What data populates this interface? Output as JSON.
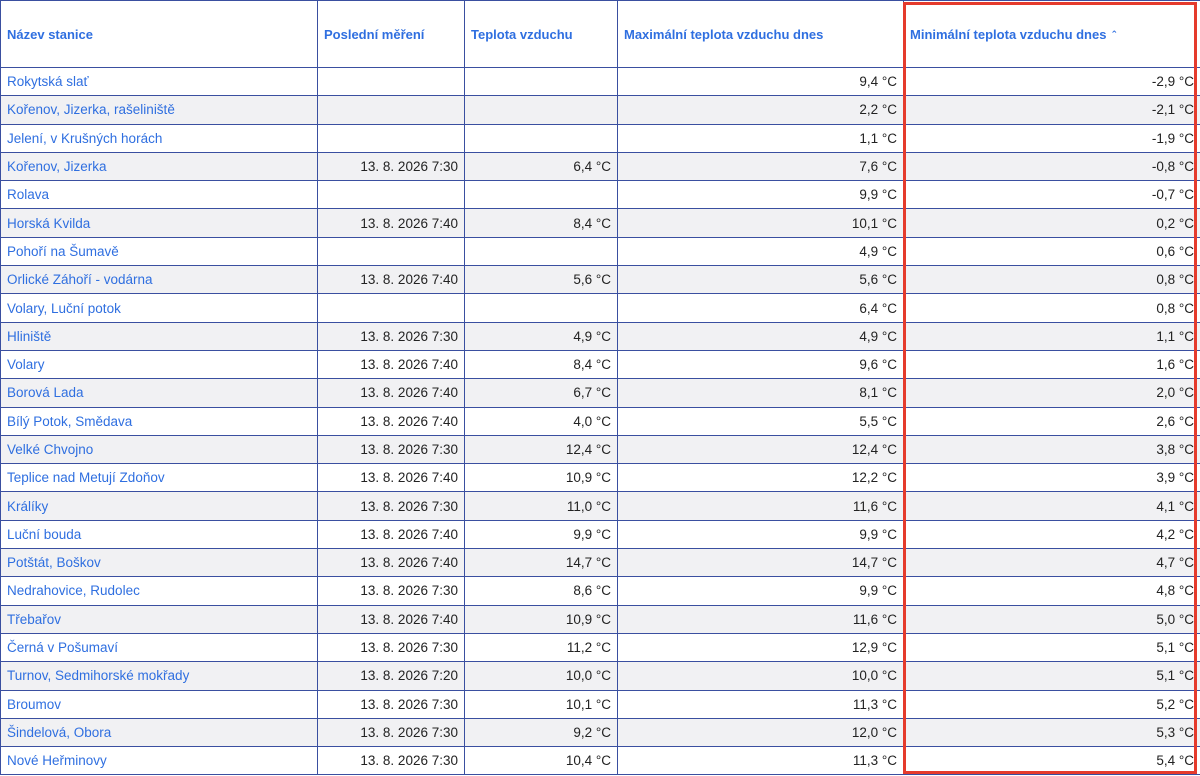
{
  "headers": {
    "station": "Název stanice",
    "last": "Poslední měření",
    "temp": "Teplota vzduchu",
    "max": "Maximální teplota vzduchu dnes",
    "min": "Minimální teplota vzduchu dnes",
    "sort_icon": "chevron-up-icon"
  },
  "colors": {
    "link": "#2f6fe0",
    "highlight": "#e53b2c",
    "grid": "#3a4fa0"
  },
  "rows": [
    {
      "station": "Rokytská slať",
      "last": "",
      "temp": "",
      "max": "9,4 °C",
      "min": "-2,9 °C"
    },
    {
      "station": "Kořenov, Jizerka, rašeliniště",
      "last": "",
      "temp": "",
      "max": "2,2 °C",
      "min": "-2,1 °C"
    },
    {
      "station": "Jelení, v Krušných horách",
      "last": "",
      "temp": "",
      "max": "1,1 °C",
      "min": "-1,9 °C"
    },
    {
      "station": "Kořenov, Jizerka",
      "last": "13. 8. 2026 7:30",
      "temp": "6,4 °C",
      "max": "7,6 °C",
      "min": "-0,8 °C"
    },
    {
      "station": "Rolava",
      "last": "",
      "temp": "",
      "max": "9,9 °C",
      "min": "-0,7 °C"
    },
    {
      "station": "Horská Kvilda",
      "last": "13. 8. 2026 7:40",
      "temp": "8,4 °C",
      "max": "10,1 °C",
      "min": "0,2 °C"
    },
    {
      "station": "Pohoří na Šumavě",
      "last": "",
      "temp": "",
      "max": "4,9 °C",
      "min": "0,6 °C"
    },
    {
      "station": "Orlické Záhoří - vodárna",
      "last": "13. 8. 2026 7:40",
      "temp": "5,6 °C",
      "max": "5,6 °C",
      "min": "0,8 °C"
    },
    {
      "station": "Volary, Luční potok",
      "last": "",
      "temp": "",
      "max": "6,4 °C",
      "min": "0,8 °C"
    },
    {
      "station": "Hliniště",
      "last": "13. 8. 2026 7:30",
      "temp": "4,9 °C",
      "max": "4,9 °C",
      "min": "1,1 °C"
    },
    {
      "station": "Volary",
      "last": "13. 8. 2026 7:40",
      "temp": "8,4 °C",
      "max": "9,6 °C",
      "min": "1,6 °C"
    },
    {
      "station": "Borová Lada",
      "last": "13. 8. 2026 7:40",
      "temp": "6,7 °C",
      "max": "8,1 °C",
      "min": "2,0 °C"
    },
    {
      "station": "Bílý Potok, Smědava",
      "last": "13. 8. 2026 7:40",
      "temp": "4,0 °C",
      "max": "5,5 °C",
      "min": "2,6 °C"
    },
    {
      "station": "Velké Chvojno",
      "last": "13. 8. 2026 7:30",
      "temp": "12,4 °C",
      "max": "12,4 °C",
      "min": "3,8 °C"
    },
    {
      "station": "Teplice nad Metují Zdoňov",
      "last": "13. 8. 2026 7:40",
      "temp": "10,9 °C",
      "max": "12,2 °C",
      "min": "3,9 °C"
    },
    {
      "station": "Králíky",
      "last": "13. 8. 2026 7:30",
      "temp": "11,0 °C",
      "max": "11,6 °C",
      "min": "4,1 °C"
    },
    {
      "station": "Luční bouda",
      "last": "13. 8. 2026 7:40",
      "temp": "9,9 °C",
      "max": "9,9 °C",
      "min": "4,2 °C"
    },
    {
      "station": "Potštát, Boškov",
      "last": "13. 8. 2026 7:40",
      "temp": "14,7 °C",
      "max": "14,7 °C",
      "min": "4,7 °C"
    },
    {
      "station": "Nedrahovice, Rudolec",
      "last": "13. 8. 2026 7:30",
      "temp": "8,6 °C",
      "max": "9,9 °C",
      "min": "4,8 °C"
    },
    {
      "station": "Třebařov",
      "last": "13. 8. 2026 7:40",
      "temp": "10,9 °C",
      "max": "11,6 °C",
      "min": "5,0 °C"
    },
    {
      "station": "Černá v Pošumaví",
      "last": "13. 8. 2026 7:30",
      "temp": "11,2 °C",
      "max": "12,9 °C",
      "min": "5,1 °C"
    },
    {
      "station": "Turnov, Sedmihorské mokřady",
      "last": "13. 8. 2026 7:20",
      "temp": "10,0 °C",
      "max": "10,0 °C",
      "min": "5,1 °C"
    },
    {
      "station": "Broumov",
      "last": "13. 8. 2026 7:30",
      "temp": "10,1 °C",
      "max": "11,3 °C",
      "min": "5,2 °C"
    },
    {
      "station": "Šindelová, Obora",
      "last": "13. 8. 2026 7:30",
      "temp": "9,2 °C",
      "max": "12,0 °C",
      "min": "5,3 °C"
    },
    {
      "station": "Nové Heřminovy",
      "last": "13. 8. 2026 7:30",
      "temp": "10,4 °C",
      "max": "11,3 °C",
      "min": "5,4 °C"
    }
  ]
}
